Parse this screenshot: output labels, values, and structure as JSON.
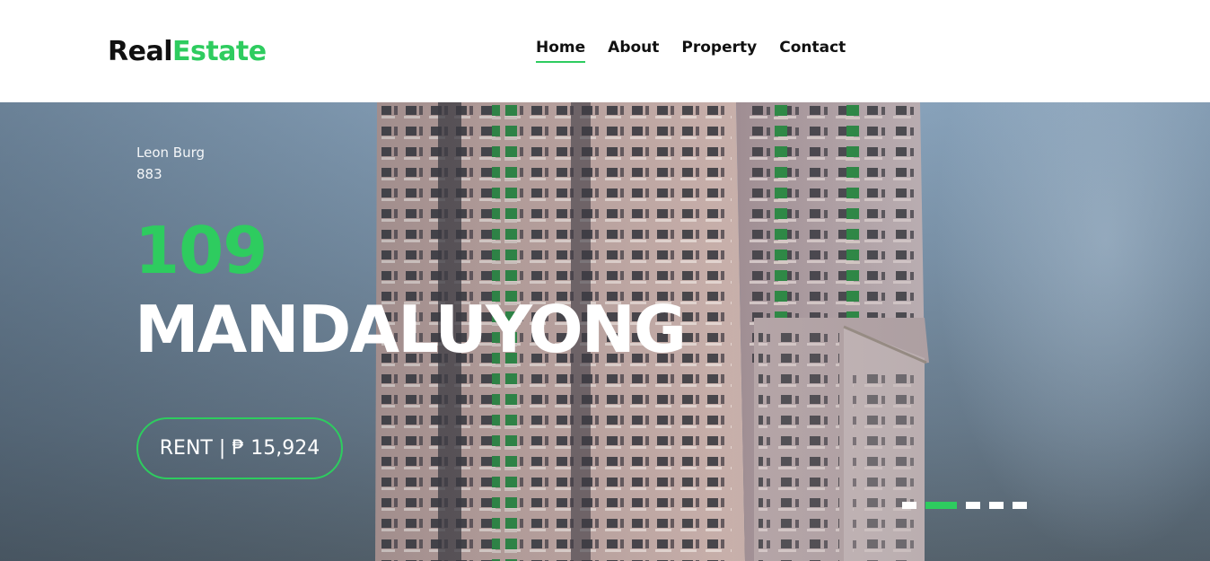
{
  "header": {
    "logo_primary": "Real",
    "logo_accent": "Estate",
    "nav": [
      {
        "label": "Home",
        "active": true
      },
      {
        "label": "About",
        "active": false
      },
      {
        "label": "Property",
        "active": false
      },
      {
        "label": "Contact",
        "active": false
      }
    ]
  },
  "hero": {
    "address_line1": "Leon Burg",
    "address_line2": "883",
    "title_number": "109",
    "title_city": "MANDALUYONG",
    "rent_button": "RENT | ₱ 15,924",
    "slides_count": 5,
    "active_slide": 2
  },
  "colors": {
    "accent": "#2ecc5f",
    "text_dark": "#111111",
    "header_bg": "#ffffff"
  }
}
